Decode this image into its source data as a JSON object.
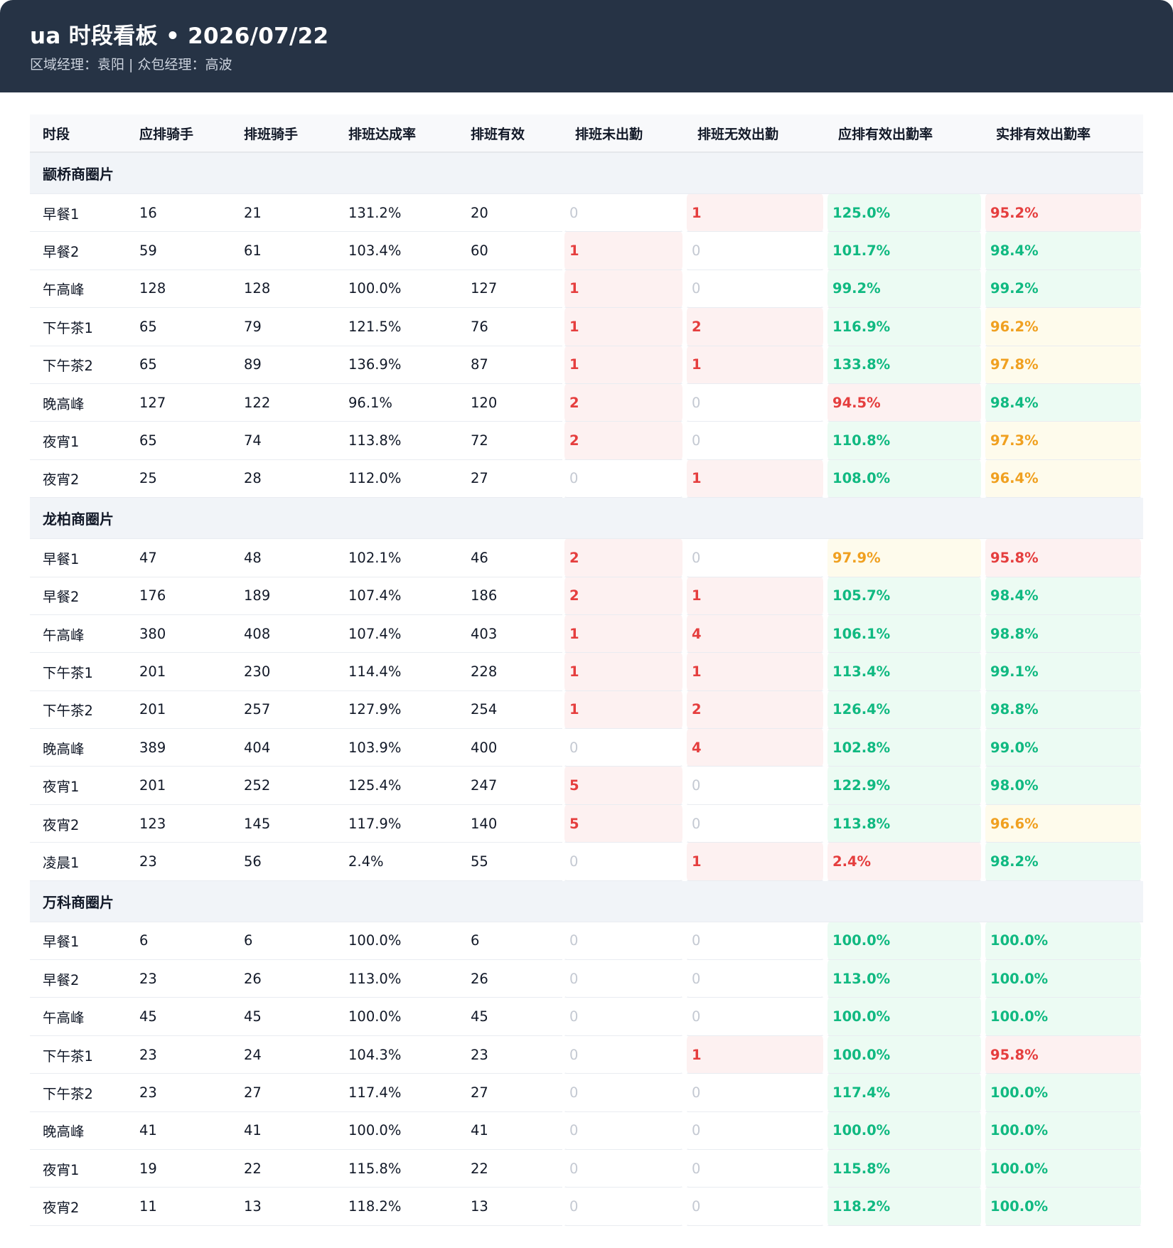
{
  "header": {
    "title": "ua 时段看板 • 2026/07/22",
    "subtitle": "区域经理：袁阳 | 众包经理：高波"
  },
  "table": {
    "columns": [
      "时段",
      "应排骑手",
      "排班骑手",
      "排班达成率",
      "排班有效",
      "排班未出勤",
      "排班无效出勤",
      "应排有效出勤率",
      "实排有效出勤率"
    ],
    "groups": [
      {
        "name": "颛桥商圈片",
        "rows": [
          {
            "slot": "早餐1",
            "planned": "16",
            "scheduled": "21",
            "rate": "131.2%",
            "valid": "20",
            "absent": "0",
            "invalid": "1",
            "planned_rate": "125.0%",
            "actual_rate": "95.2%",
            "pr_status": "green",
            "ar_status": "red"
          },
          {
            "slot": "早餐2",
            "planned": "59",
            "scheduled": "61",
            "rate": "103.4%",
            "valid": "60",
            "absent": "1",
            "invalid": "0",
            "planned_rate": "101.7%",
            "actual_rate": "98.4%",
            "pr_status": "green",
            "ar_status": "green"
          },
          {
            "slot": "午高峰",
            "planned": "128",
            "scheduled": "128",
            "rate": "100.0%",
            "valid": "127",
            "absent": "1",
            "invalid": "0",
            "planned_rate": "99.2%",
            "actual_rate": "99.2%",
            "pr_status": "green",
            "ar_status": "green"
          },
          {
            "slot": "下午茶1",
            "planned": "65",
            "scheduled": "79",
            "rate": "121.5%",
            "valid": "76",
            "absent": "1",
            "invalid": "2",
            "planned_rate": "116.9%",
            "actual_rate": "96.2%",
            "pr_status": "green",
            "ar_status": "orange"
          },
          {
            "slot": "下午茶2",
            "planned": "65",
            "scheduled": "89",
            "rate": "136.9%",
            "valid": "87",
            "absent": "1",
            "invalid": "1",
            "planned_rate": "133.8%",
            "actual_rate": "97.8%",
            "pr_status": "green",
            "ar_status": "orange"
          },
          {
            "slot": "晚高峰",
            "planned": "127",
            "scheduled": "122",
            "rate": "96.1%",
            "valid": "120",
            "absent": "2",
            "invalid": "0",
            "planned_rate": "94.5%",
            "actual_rate": "98.4%",
            "pr_status": "red",
            "ar_status": "green"
          },
          {
            "slot": "夜宵1",
            "planned": "65",
            "scheduled": "74",
            "rate": "113.8%",
            "valid": "72",
            "absent": "2",
            "invalid": "0",
            "planned_rate": "110.8%",
            "actual_rate": "97.3%",
            "pr_status": "green",
            "ar_status": "orange"
          },
          {
            "slot": "夜宵2",
            "planned": "25",
            "scheduled": "28",
            "rate": "112.0%",
            "valid": "27",
            "absent": "0",
            "invalid": "1",
            "planned_rate": "108.0%",
            "actual_rate": "96.4%",
            "pr_status": "green",
            "ar_status": "orange"
          }
        ]
      },
      {
        "name": "龙柏商圈片",
        "rows": [
          {
            "slot": "早餐1",
            "planned": "47",
            "scheduled": "48",
            "rate": "102.1%",
            "valid": "46",
            "absent": "2",
            "invalid": "0",
            "planned_rate": "97.9%",
            "actual_rate": "95.8%",
            "pr_status": "orange",
            "ar_status": "red"
          },
          {
            "slot": "早餐2",
            "planned": "176",
            "scheduled": "189",
            "rate": "107.4%",
            "valid": "186",
            "absent": "2",
            "invalid": "1",
            "planned_rate": "105.7%",
            "actual_rate": "98.4%",
            "pr_status": "green",
            "ar_status": "green"
          },
          {
            "slot": "午高峰",
            "planned": "380",
            "scheduled": "408",
            "rate": "107.4%",
            "valid": "403",
            "absent": "1",
            "invalid": "4",
            "planned_rate": "106.1%",
            "actual_rate": "98.8%",
            "pr_status": "green",
            "ar_status": "green"
          },
          {
            "slot": "下午茶1",
            "planned": "201",
            "scheduled": "230",
            "rate": "114.4%",
            "valid": "228",
            "absent": "1",
            "invalid": "1",
            "planned_rate": "113.4%",
            "actual_rate": "99.1%",
            "pr_status": "green",
            "ar_status": "green"
          },
          {
            "slot": "下午茶2",
            "planned": "201",
            "scheduled": "257",
            "rate": "127.9%",
            "valid": "254",
            "absent": "1",
            "invalid": "2",
            "planned_rate": "126.4%",
            "actual_rate": "98.8%",
            "pr_status": "green",
            "ar_status": "green"
          },
          {
            "slot": "晚高峰",
            "planned": "389",
            "scheduled": "404",
            "rate": "103.9%",
            "valid": "400",
            "absent": "0",
            "invalid": "4",
            "planned_rate": "102.8%",
            "actual_rate": "99.0%",
            "pr_status": "green",
            "ar_status": "green"
          },
          {
            "slot": "夜宵1",
            "planned": "201",
            "scheduled": "252",
            "rate": "125.4%",
            "valid": "247",
            "absent": "5",
            "invalid": "0",
            "planned_rate": "122.9%",
            "actual_rate": "98.0%",
            "pr_status": "green",
            "ar_status": "green"
          },
          {
            "slot": "夜宵2",
            "planned": "123",
            "scheduled": "145",
            "rate": "117.9%",
            "valid": "140",
            "absent": "5",
            "invalid": "0",
            "planned_rate": "113.8%",
            "actual_rate": "96.6%",
            "pr_status": "green",
            "ar_status": "orange"
          },
          {
            "slot": "凌晨1",
            "planned": "23",
            "scheduled": "56",
            "rate": "2.4%",
            "valid": "55",
            "absent": "0",
            "invalid": "1",
            "planned_rate": "2.4%",
            "actual_rate": "98.2%",
            "pr_status": "red",
            "ar_status": "green"
          }
        ]
      },
      {
        "name": "万科商圈片",
        "rows": [
          {
            "slot": "早餐1",
            "planned": "6",
            "scheduled": "6",
            "rate": "100.0%",
            "valid": "6",
            "absent": "0",
            "invalid": "0",
            "planned_rate": "100.0%",
            "actual_rate": "100.0%",
            "pr_status": "green",
            "ar_status": "green"
          },
          {
            "slot": "早餐2",
            "planned": "23",
            "scheduled": "26",
            "rate": "113.0%",
            "valid": "26",
            "absent": "0",
            "invalid": "0",
            "planned_rate": "113.0%",
            "actual_rate": "100.0%",
            "pr_status": "green",
            "ar_status": "green"
          },
          {
            "slot": "午高峰",
            "planned": "45",
            "scheduled": "45",
            "rate": "100.0%",
            "valid": "45",
            "absent": "0",
            "invalid": "0",
            "planned_rate": "100.0%",
            "actual_rate": "100.0%",
            "pr_status": "green",
            "ar_status": "green"
          },
          {
            "slot": "下午茶1",
            "planned": "23",
            "scheduled": "24",
            "rate": "104.3%",
            "valid": "23",
            "absent": "0",
            "invalid": "1",
            "planned_rate": "100.0%",
            "actual_rate": "95.8%",
            "pr_status": "green",
            "ar_status": "red"
          },
          {
            "slot": "下午茶2",
            "planned": "23",
            "scheduled": "27",
            "rate": "117.4%",
            "valid": "27",
            "absent": "0",
            "invalid": "0",
            "planned_rate": "117.4%",
            "actual_rate": "100.0%",
            "pr_status": "green",
            "ar_status": "green"
          },
          {
            "slot": "晚高峰",
            "planned": "41",
            "scheduled": "41",
            "rate": "100.0%",
            "valid": "41",
            "absent": "0",
            "invalid": "0",
            "planned_rate": "100.0%",
            "actual_rate": "100.0%",
            "pr_status": "green",
            "ar_status": "green"
          },
          {
            "slot": "夜宵1",
            "planned": "19",
            "scheduled": "22",
            "rate": "115.8%",
            "valid": "22",
            "absent": "0",
            "invalid": "0",
            "planned_rate": "115.8%",
            "actual_rate": "100.0%",
            "pr_status": "green",
            "ar_status": "green"
          },
          {
            "slot": "夜宵2",
            "planned": "11",
            "scheduled": "13",
            "rate": "118.2%",
            "valid": "13",
            "absent": "0",
            "invalid": "0",
            "planned_rate": "118.2%",
            "actual_rate": "100.0%",
            "pr_status": "green",
            "ar_status": "green"
          }
        ]
      }
    ]
  },
  "colors": {
    "header_bg": "#263345",
    "red": "#e53e3e",
    "green": "#10b981",
    "orange": "#f0a020",
    "zero": "#c4c9d2"
  }
}
